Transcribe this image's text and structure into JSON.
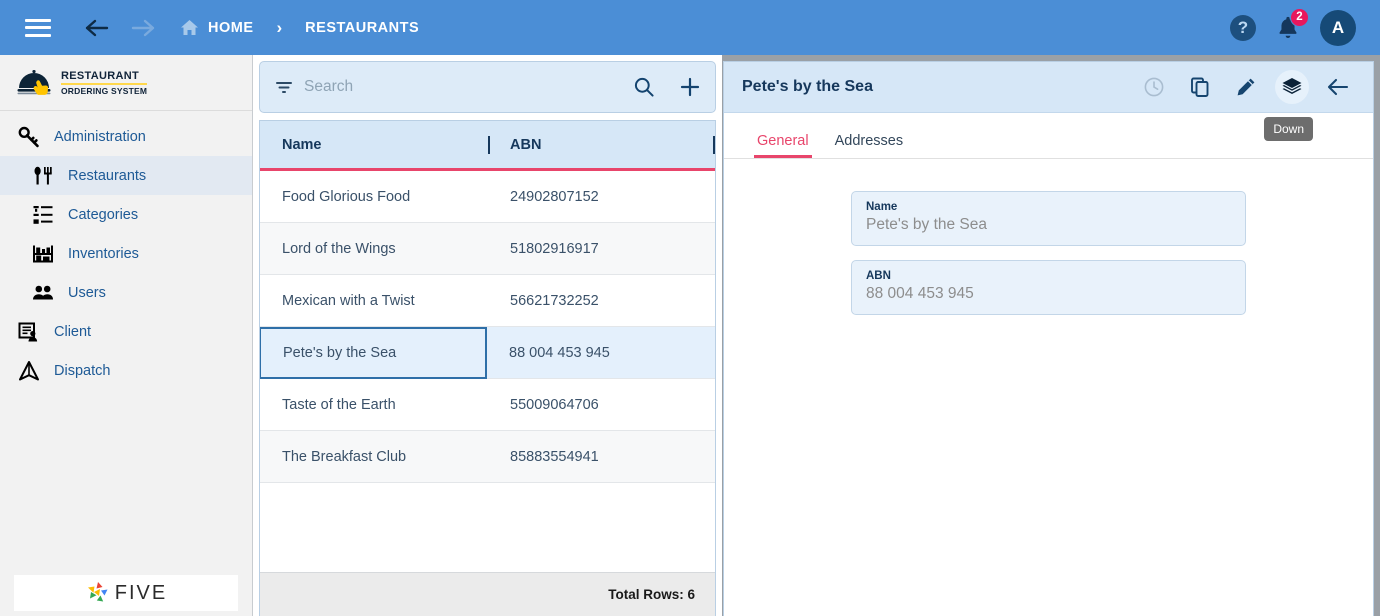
{
  "topbar": {
    "menu_icon": "hamburger-menu-icon",
    "back_icon": "arrow-back-icon",
    "forward_icon": "arrow-forward-icon",
    "home_label": "HOME",
    "breadcrumb_sep": "›",
    "current_label": "RESTAURANTS",
    "help_label": "?",
    "notification_count": "2",
    "avatar_initial": "A",
    "bg_color": "#4b8ed6"
  },
  "sidebar": {
    "brand_line1": "RESTAURANT",
    "brand_line2": "ORDERING SYSTEM",
    "footer_logo_text": "FIVE",
    "items": [
      {
        "label": "Administration",
        "icon": "key-icon",
        "level": 0,
        "active": false
      },
      {
        "label": "Restaurants",
        "icon": "cutlery-icon",
        "level": 1,
        "active": true
      },
      {
        "label": "Categories",
        "icon": "list-settings-icon",
        "level": 1,
        "active": false
      },
      {
        "label": "Inventories",
        "icon": "shelf-icon",
        "level": 1,
        "active": false
      },
      {
        "label": "Users",
        "icon": "users-icon",
        "level": 1,
        "active": false
      },
      {
        "label": "Client",
        "icon": "document-person-icon",
        "level": 0,
        "active": false
      },
      {
        "label": "Dispatch",
        "icon": "navigation-arrow-icon",
        "level": 0,
        "active": false
      }
    ]
  },
  "list_pane": {
    "search": {
      "placeholder": "Search",
      "value": "",
      "filter_icon": "filter-icon",
      "search_icon": "search-icon",
      "add_icon": "plus-icon"
    },
    "columns": [
      "Name",
      "ABN"
    ],
    "rows": [
      {
        "name": "Food Glorious Food",
        "abn": "24902807152",
        "selected": false
      },
      {
        "name": "Lord of the Wings",
        "abn": "51802916917",
        "selected": false
      },
      {
        "name": "Mexican with a Twist",
        "abn": "56621732252",
        "selected": false
      },
      {
        "name": "Pete's by the Sea",
        "abn": "88 004 453 945",
        "selected": true
      },
      {
        "name": "Taste of the Earth",
        "abn": "55009064706",
        "selected": false
      },
      {
        "name": "The Breakfast Club",
        "abn": "85883554941",
        "selected": false
      }
    ],
    "footer_text": "Total Rows: 6",
    "header_accent_color": "#e8456b"
  },
  "detail_pane": {
    "title": "Pete's by the Sea",
    "actions": [
      {
        "name": "history-clock-icon",
        "state": "disabled"
      },
      {
        "name": "copy-icon",
        "state": "normal"
      },
      {
        "name": "edit-pencil-icon",
        "state": "normal"
      },
      {
        "name": "layers-icon",
        "state": "highlight"
      },
      {
        "name": "arrow-back-icon",
        "state": "normal"
      }
    ],
    "tabs": [
      {
        "label": "General",
        "active": true
      },
      {
        "label": "Addresses",
        "active": false
      }
    ],
    "tooltip": "Down",
    "fields": [
      {
        "label": "Name",
        "value": "Pete's by the Sea"
      },
      {
        "label": "ABN",
        "value": "88 004 453 945"
      }
    ]
  }
}
